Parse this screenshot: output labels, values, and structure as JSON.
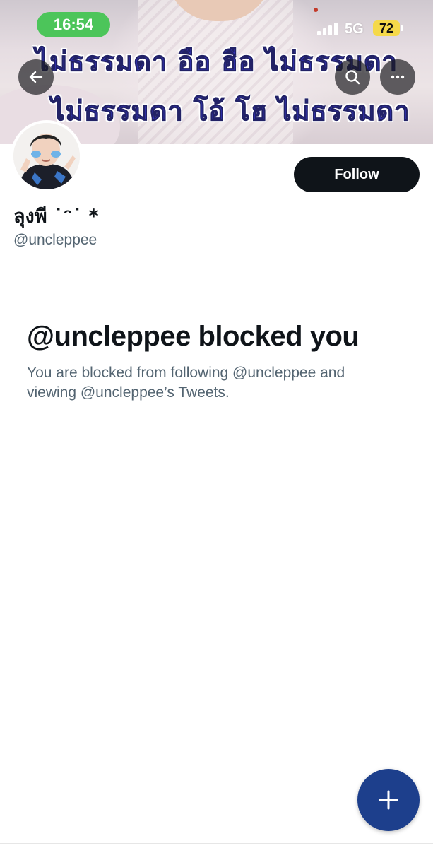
{
  "status_bar": {
    "time": "16:54",
    "network": "5G",
    "battery": "72"
  },
  "banner": {
    "caption_line1": "ไม่ธรรมดา อือ ฮือ ไม่ธรรมดา",
    "caption_line2": "ไม่ธรรมดา โอ้ โฮ ไม่ธรรมดา"
  },
  "profile": {
    "display_name": "ลุงพี ˙ᵔ˙ *",
    "handle": "@uncleppee",
    "follow_label": "Follow"
  },
  "blocked": {
    "title": "@uncleppee blocked you",
    "message": "You are blocked from following @uncleppee and viewing @uncleppee’s Tweets."
  },
  "icons": {
    "back": "arrow-left-icon",
    "search": "search-icon",
    "more": "more-horizontal-icon",
    "compose": "plus-icon"
  },
  "colors": {
    "follow_button": "#0f1419",
    "fab": "#1d3f8c",
    "time_pill": "#4cc55a",
    "battery": "#f5d94a"
  }
}
